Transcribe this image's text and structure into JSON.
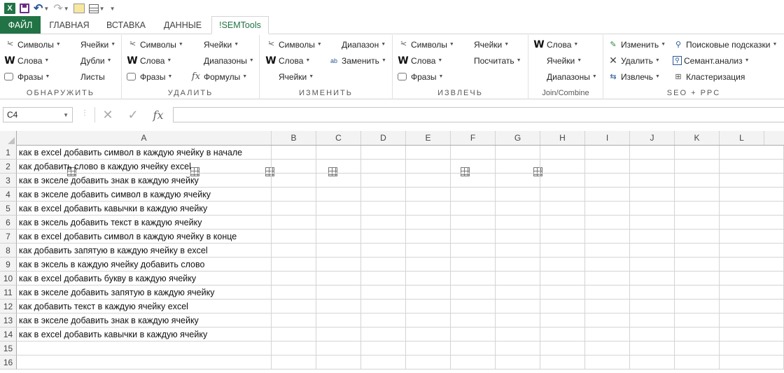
{
  "qat": {
    "logo": "X",
    "undo": "↶",
    "redo": "↷"
  },
  "tabs": [
    {
      "label": "ФАЙЛ"
    },
    {
      "label": "ГЛАВНАЯ"
    },
    {
      "label": "ВСТАВКА"
    },
    {
      "label": "ДАННЫЕ"
    },
    {
      "label": "!SEMTools"
    }
  ],
  "ribbon": {
    "groups": {
      "obnaruzhit": {
        "label": "ОБНАРУЖИТЬ",
        "col1": [
          "Символы",
          "Слова",
          "Фразы"
        ],
        "col2": [
          "Ячейки",
          "Дубли",
          "Листы"
        ]
      },
      "udalit": {
        "label": "УДАЛИТЬ",
        "col1": [
          "Символы",
          "Слова",
          "Фразы"
        ],
        "col2": [
          "Ячейки",
          "Диапазоны",
          "Формулы"
        ]
      },
      "izmenit": {
        "label": "ИЗМЕНИТЬ",
        "col1": [
          "Символы",
          "Слова",
          "Ячейки"
        ],
        "col2": [
          "Диапазон",
          "Заменить"
        ]
      },
      "izvlech": {
        "label": "ИЗВЛЕЧЬ",
        "col1": [
          "Символы",
          "Слова",
          "Фразы"
        ],
        "col2": [
          "Ячейки",
          "Посчитать"
        ]
      },
      "join": {
        "label": "Join/Combine",
        "col1": [
          "Слова",
          "Ячейки",
          "Диапазоны"
        ]
      },
      "seo": {
        "label": "SEO + PPC",
        "col1": [
          "Изменить",
          "Удалить",
          "Извлечь"
        ],
        "col2": [
          "Поисковые подсказки",
          "Семант.анализ",
          "Кластеризация"
        ]
      }
    }
  },
  "formula_bar": {
    "name_box": "C4",
    "cancel": "✕",
    "enter": "✓",
    "fx": "fx",
    "value": ""
  },
  "columns": [
    "A",
    "B",
    "C",
    "D",
    "E",
    "F",
    "G",
    "H",
    "I",
    "J",
    "K",
    "L"
  ],
  "rows": [
    {
      "n": "1",
      "a": "как в excel добавить символ в каждую ячейку в начале"
    },
    {
      "n": "2",
      "a": "как добавить слово в каждую ячейку excel"
    },
    {
      "n": "3",
      "a": "как в экселе добавить знак в каждую ячейку"
    },
    {
      "n": "4",
      "a": "как в экселе добавить символ в каждую ячейку"
    },
    {
      "n": "5",
      "a": "как в excel добавить кавычки в каждую ячейку"
    },
    {
      "n": "6",
      "a": "как в эксель добавить текст в каждую ячейку"
    },
    {
      "n": "7",
      "a": "как в excel добавить символ в каждую ячейку в конце"
    },
    {
      "n": "8",
      "a": "как добавить запятую в каждую ячейку в excel"
    },
    {
      "n": "9",
      "a": "как в эксель в каждую ячейку добавить слово"
    },
    {
      "n": "10",
      "a": "как в excel добавить букву в каждую ячейку"
    },
    {
      "n": "11",
      "a": "как в экселе добавить запятую в каждую ячейку"
    },
    {
      "n": "12",
      "a": "как добавить текст в каждую ячейку excel"
    },
    {
      "n": "13",
      "a": "как в экселе добавить знак в каждую ячейку"
    },
    {
      "n": "14",
      "a": "как в excel добавить кавычки в каждую ячейку"
    },
    {
      "n": "15",
      "a": ""
    },
    {
      "n": "16",
      "a": ""
    }
  ]
}
